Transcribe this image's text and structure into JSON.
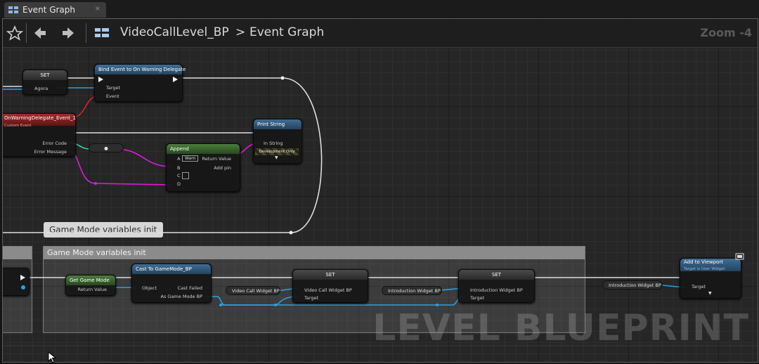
{
  "tab": {
    "label": "Event Graph",
    "close": "×"
  },
  "toolbar": {
    "breadcrumb_root": "VideoCallLevel_BP",
    "breadcrumb_sep": ">",
    "breadcrumb_current": "Event Graph",
    "zoom": "Zoom -4"
  },
  "nodes": {
    "set_agora": {
      "title": "SET",
      "pin": "Agora"
    },
    "bind_event": {
      "title": "Bind Event to On Warning Delegate",
      "target": "Target",
      "event": "Event"
    },
    "custom_event": {
      "title": "OnWarningDelegate_Event_1",
      "subtitle": "Custom Event",
      "pin1": "Error Code",
      "pin2": "Error Message"
    },
    "print_string": {
      "title": "Print String",
      "in_string": "In String",
      "dev_only": "Development Only"
    },
    "append": {
      "title": "Append",
      "a": "A",
      "a_value": "Warn",
      "b": "B",
      "c": "C",
      "d": "D",
      "return": "Return Value",
      "add_pin": "Add pin"
    },
    "convert": {
      "label": "●"
    },
    "get_game_mode": {
      "title": "Get Game Mode",
      "return": "Return Value"
    },
    "cast": {
      "title": "Cast To GameMode_BP",
      "object": "Object",
      "failed": "Cast Failed",
      "as": "As Game Mode BP"
    },
    "var_video": {
      "label": "Video Call Widget BP"
    },
    "set_video": {
      "title": "SET",
      "pin": "Video Call Widget BP",
      "target": "Target"
    },
    "var_intro": {
      "label": "Introduction Widget BP"
    },
    "set_intro": {
      "title": "SET",
      "pin": "Introduction Widget BP",
      "target": "Target"
    },
    "var_intro2": {
      "label": "Introduction Widget BP"
    },
    "add_viewport": {
      "title": "Add to Viewport",
      "subtitle": "Target is User Widget",
      "target": "Target"
    }
  },
  "comment": {
    "bubble": "Game Mode variables init",
    "title": "Game Mode variables init"
  },
  "watermark": "LEVEL BLUEPRINT"
}
